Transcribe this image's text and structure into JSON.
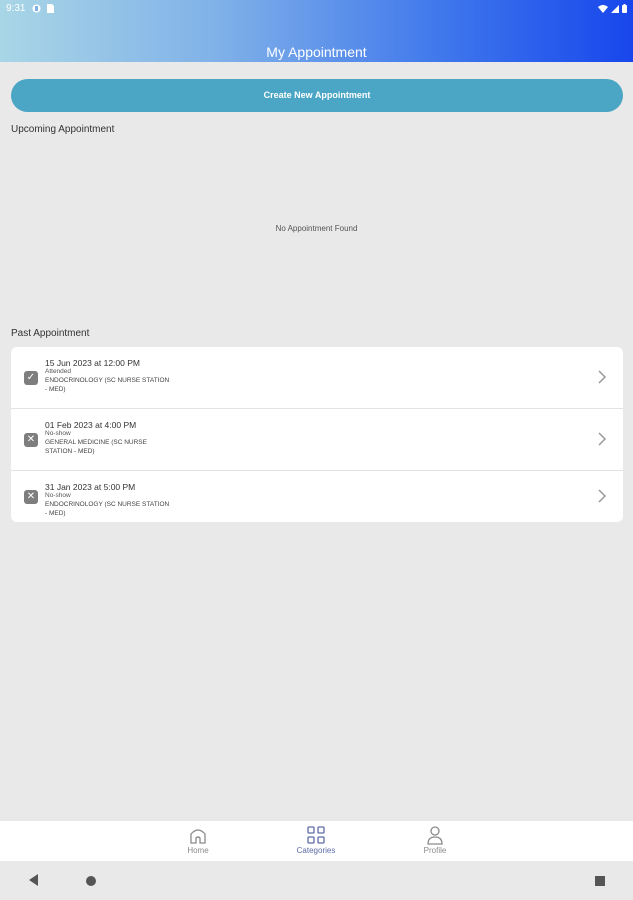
{
  "status_bar": {
    "time": "9:31"
  },
  "header": {
    "title": "My Appointment"
  },
  "actions": {
    "create_label": "Create New Appointment"
  },
  "upcoming": {
    "label": "Upcoming Appointment",
    "empty_message": "No Appointment Found"
  },
  "past": {
    "label": "Past Appointment",
    "items": [
      {
        "date": "15 Jun 2023 at 12:00 PM",
        "status": "Attended",
        "dept_line1": "ENDOCRINOLOGY (SC NURSE STATION",
        "dept_line2": "- MED)",
        "icon": "check-icon"
      },
      {
        "date": "01 Feb 2023 at 4:00 PM",
        "status": "No-show",
        "dept_line1": "GENERAL MEDICINE (SC NURSE",
        "dept_line2": "STATION - MED)",
        "icon": "cross-icon"
      },
      {
        "date": "31 Jan 2023 at 5:00 PM",
        "status": "No-show",
        "dept_line1": "ENDOCRINOLOGY (SC NURSE STATION",
        "dept_line2": "- MED)",
        "icon": "cross-icon"
      }
    ]
  },
  "bottom_nav": {
    "home": "Home",
    "categories": "Categories",
    "profile": "Profile",
    "active": "categories"
  },
  "colors": {
    "primary_button": "#4aa6c4",
    "header_gradient_start": "#a9d6e6",
    "header_gradient_end": "#1846ec",
    "active_nav": "#5d6aa8"
  }
}
